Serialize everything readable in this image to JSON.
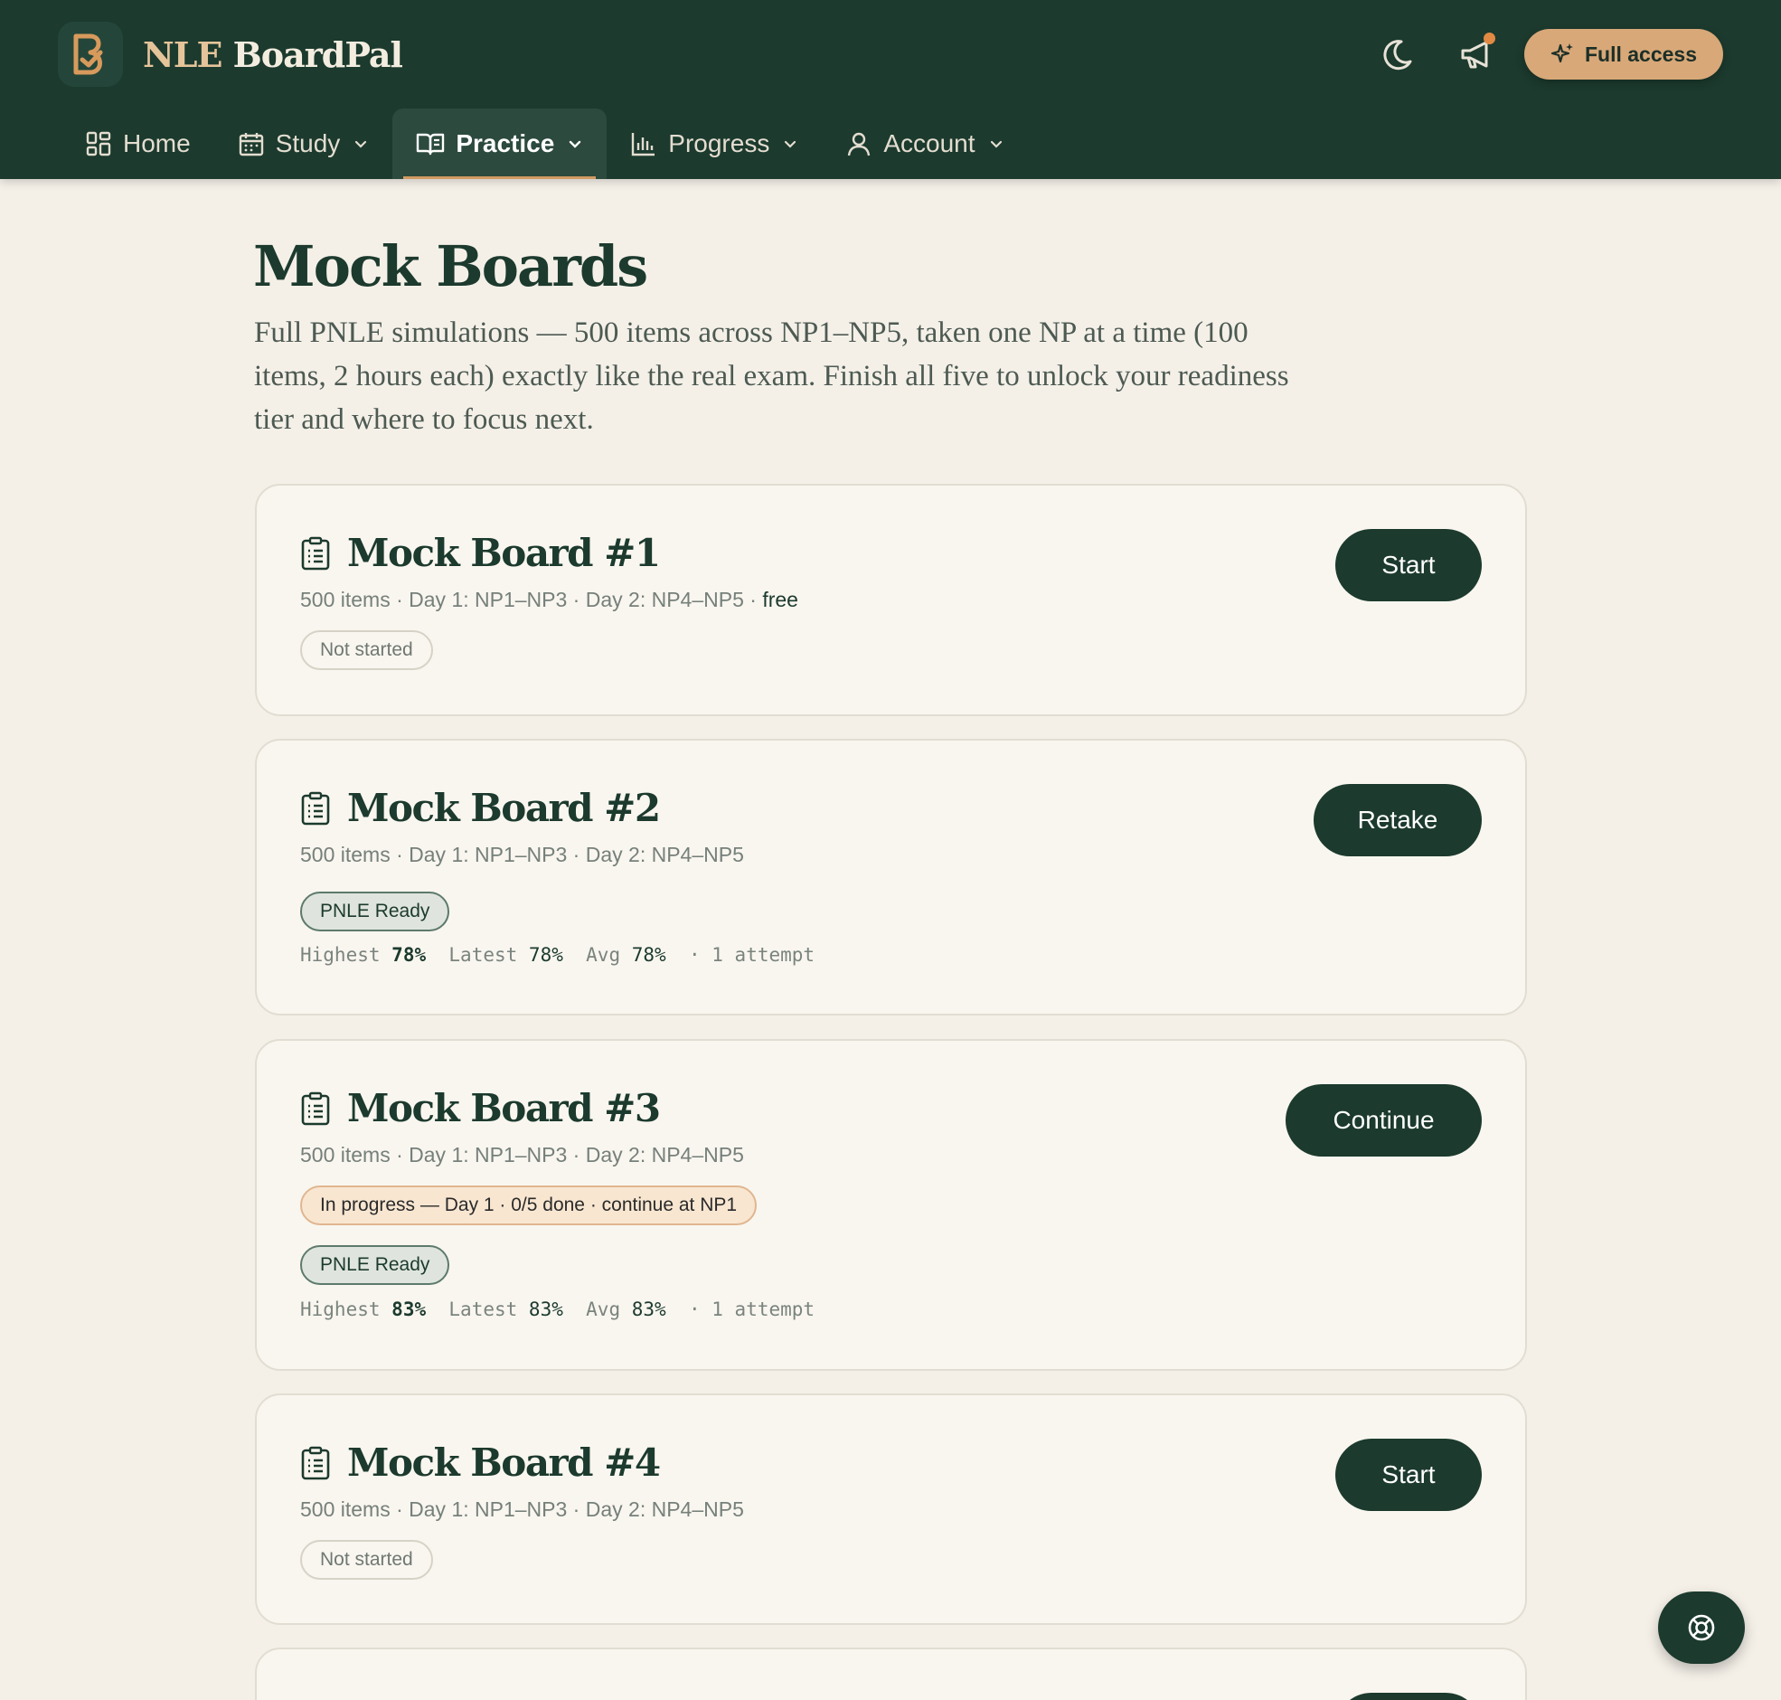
{
  "brand": {
    "prefix": "NLE",
    "name": " BoardPal"
  },
  "header": {
    "full_access_label": "Full access"
  },
  "nav": {
    "home": "Home",
    "study": "Study",
    "practice": "Practice",
    "progress": "Progress",
    "account": "Account"
  },
  "page": {
    "title": "Mock Boards",
    "description": "Full PNLE simulations — 500 items across NP1–NP5, taken one NP at a time (100 items, 2 hours each) exactly like the real exam. Finish all five to unlock your readiness tier and where to focus next."
  },
  "cards": [
    {
      "title": "Mock Board #1",
      "meta": "500 items · Day 1: NP1–NP3 · Day 2: NP4–NP5 · ",
      "free": "free",
      "status": "Not started",
      "button": "Start"
    },
    {
      "title": "Mock Board #2",
      "meta": "500 items · Day 1: NP1–NP3 · Day 2: NP4–NP5",
      "tier": "PNLE Ready",
      "stats": {
        "highest_label": "Highest",
        "highest": "78%",
        "latest_label": "Latest",
        "latest": "78%",
        "avg_label": "Avg",
        "avg": "78%",
        "attempts": "· 1 attempt"
      },
      "button": "Retake"
    },
    {
      "title": "Mock Board #3",
      "meta": "500 items · Day 1: NP1–NP3 · Day 2: NP4–NP5",
      "progress": "In progress — Day 1 · 0/5 done · continue at NP1",
      "tier": "PNLE Ready",
      "stats": {
        "highest_label": "Highest",
        "highest": "83%",
        "latest_label": "Latest",
        "latest": "83%",
        "avg_label": "Avg",
        "avg": "83%",
        "attempts": "· 1 attempt"
      },
      "button": "Continue"
    },
    {
      "title": "Mock Board #4",
      "meta": "500 items · Day 1: NP1–NP3 · Day 2: NP4–NP5",
      "status": "Not started",
      "button": "Start"
    }
  ],
  "colors": {
    "header_bg": "#1c3a2e",
    "accent": "#d8a878",
    "page_bg": "#f4f0e8",
    "card_bg": "#f9f6ef"
  },
  "icons": {
    "logo": "b-check-logo-icon",
    "theme": "moon-icon",
    "announcements": "megaphone-icon",
    "full_access": "sparkle-icon",
    "home": "grid-icon",
    "study": "calendar-icon",
    "practice": "open-book-icon",
    "progress": "bar-chart-icon",
    "account": "user-icon",
    "card": "clipboard-icon",
    "help": "lifebuoy-icon"
  }
}
